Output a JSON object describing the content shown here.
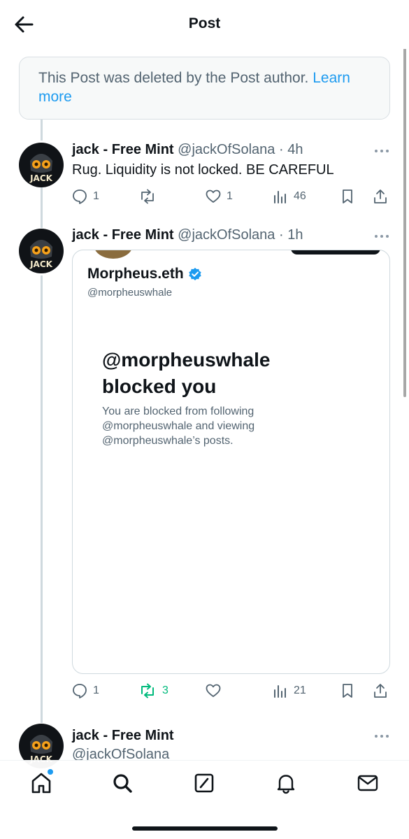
{
  "header": {
    "title": "Post"
  },
  "deleted_notice": {
    "text": "This Post was deleted by the Post author. ",
    "link": "Learn more"
  },
  "posts": [
    {
      "name": "jack - Free Mint",
      "handle": "@jackOfSolana",
      "time": "4h",
      "text": "Rug. Liquidity is not locked. BE CAREFUL",
      "avatar_text": "JACK",
      "actions": {
        "replies": "1",
        "reposts": "",
        "likes": "1",
        "views": "46"
      }
    },
    {
      "name": "jack - Free Mint",
      "handle": "@jackOfSolana",
      "time": "1h",
      "avatar_text": "JACK",
      "media": {
        "profile_name": "Morpheus.eth",
        "profile_handle": "@morpheuswhale",
        "blocked_title": "@morpheuswhale blocked you",
        "blocked_desc": "You are blocked from following @morpheuswhale and viewing @morpheuswhale’s posts."
      },
      "actions": {
        "replies": "1",
        "reposts": "3",
        "likes": "",
        "views": "21"
      }
    },
    {
      "name": "jack - Free Mint",
      "handle": "@jackOfSolana",
      "avatar_text": "JACK"
    }
  ],
  "colors": {
    "accent": "#1d9bf0",
    "repost_active": "#00ba7c",
    "muted": "#536471",
    "text": "#0f1419"
  },
  "nav": [
    "home-icon",
    "search-icon",
    "compose-icon",
    "notifications-icon",
    "messages-icon"
  ]
}
